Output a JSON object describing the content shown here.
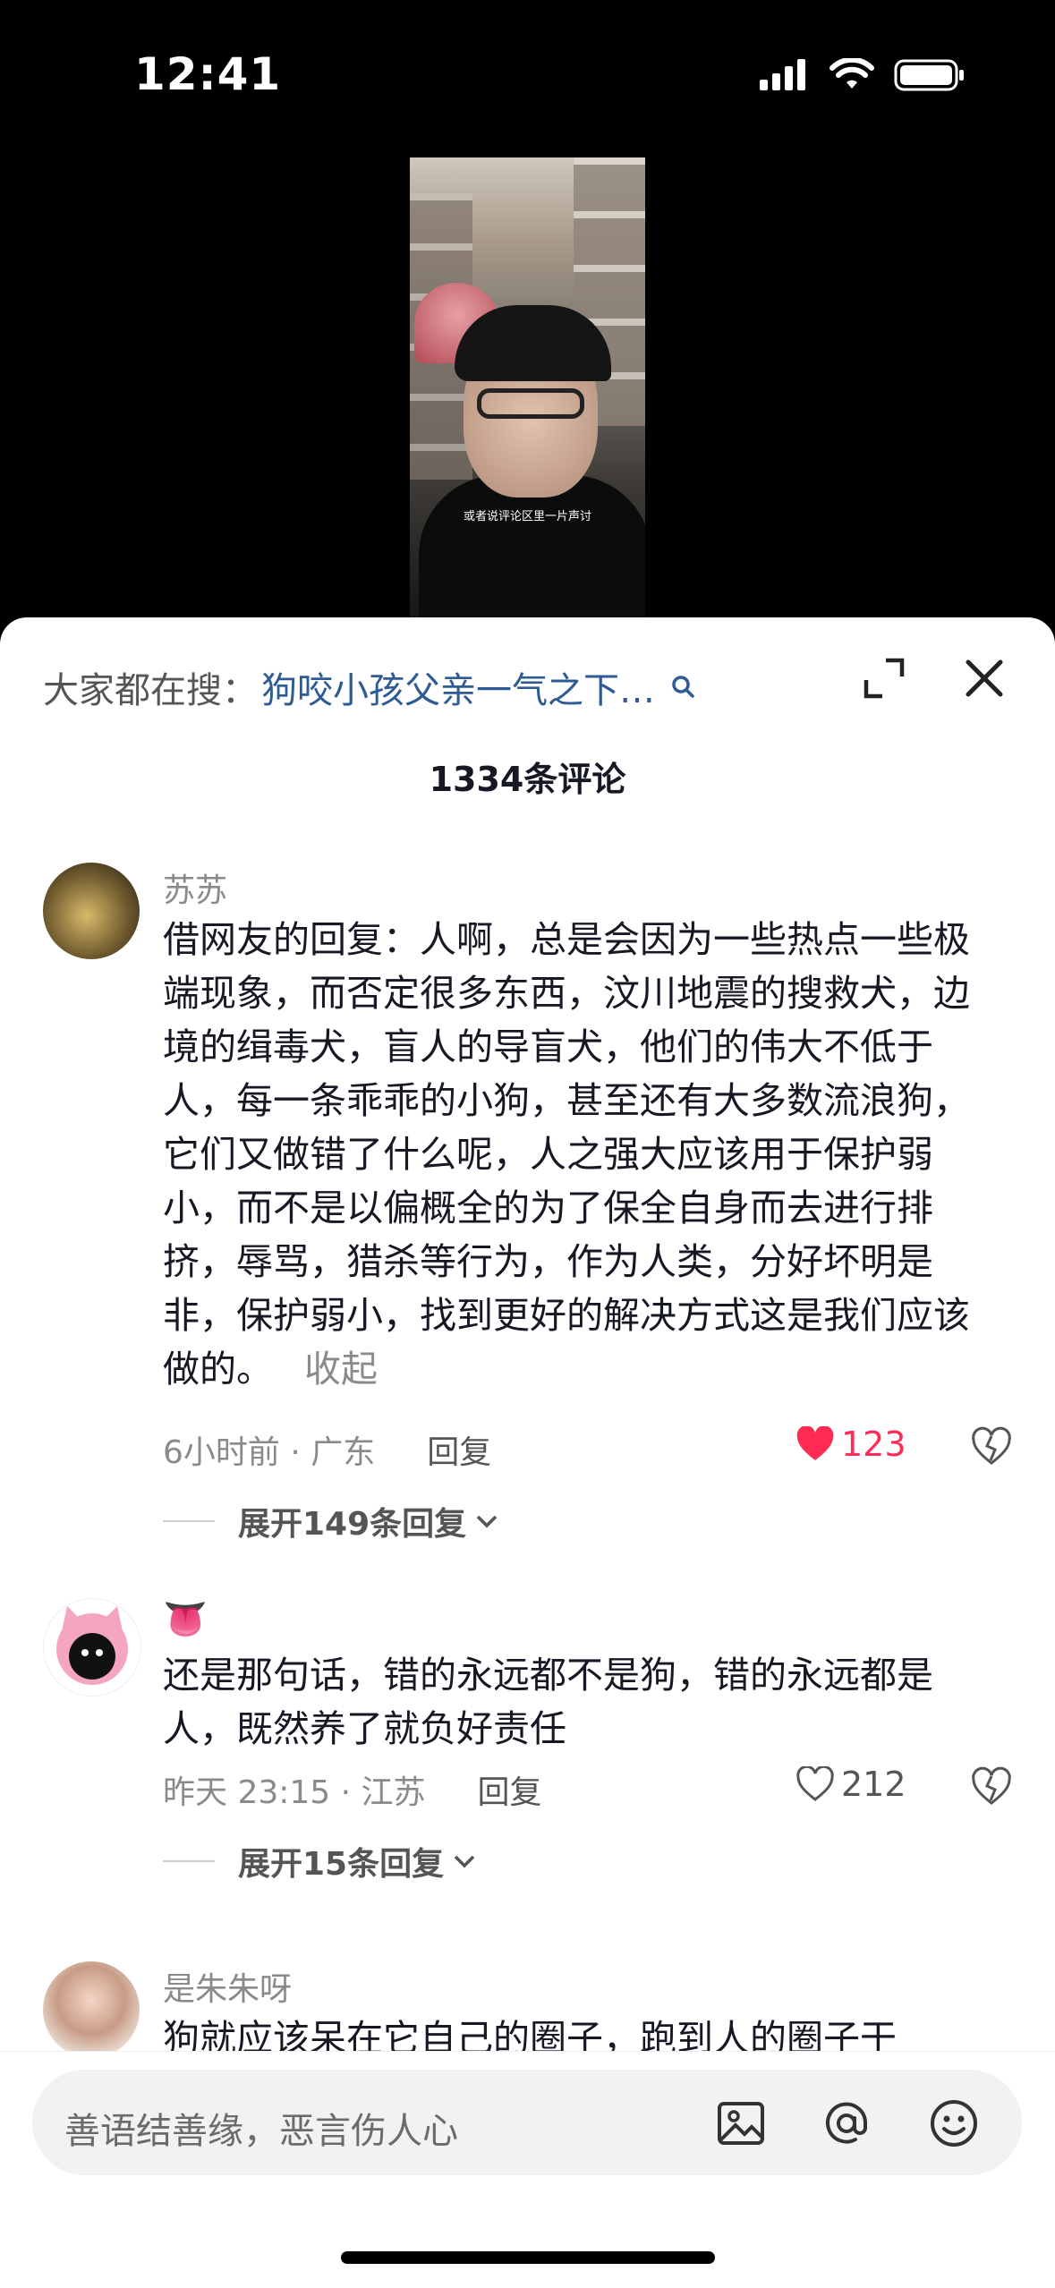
{
  "status_bar": {
    "time": "12:41"
  },
  "video": {
    "caption": "或者说评论区里一片声讨"
  },
  "sheet": {
    "search_label": "大家都在搜：",
    "search_query": "狗咬小孩父亲一气之下…",
    "comment_count": "1334条评论"
  },
  "comments": [
    {
      "username": "苏苏",
      "text": "借网友的回复：人啊，总是会因为一些热点一些极端现象，而否定很多东西，汶川地震的搜救犬，边境的缉毒犬，盲人的导盲犬，他们的伟大不低于人，每一条乖乖的小狗，甚至还有大多数流浪狗，它们又做错了什么呢，人之强大应该用于保护弱小，而不是以偏概全的为了保全自身而去进行排挤，辱骂，猎杀等行为，作为人类，分好坏明是非，保护弱小，找到更好的解决方式这是我们应该做的。",
      "collapse_label": "收起",
      "meta": "6小时前 · 广东",
      "reply_label": "回复",
      "likes": "123",
      "liked": true,
      "expand_replies": "展开149条回复"
    },
    {
      "username": "👅",
      "text": "还是那句话，错的永远都不是狗，错的永远都是人，既然养了就负好责任",
      "meta": "昨天 23:15 · 江苏",
      "reply_label": "回复",
      "likes": "212",
      "liked": false,
      "expand_replies": "展开15条回复"
    },
    {
      "username": "是朱朱呀",
      "text": "狗就应该呆在它自己的圈子，跑到人的圈子干"
    }
  ],
  "input": {
    "placeholder": "善语结善缘，恶言伤人心"
  },
  "colors": {
    "like_active": "#fe2c55",
    "search_query": "#2f5b95"
  },
  "icons": [
    "signal-icon",
    "wifi-icon",
    "battery-icon",
    "search-icon",
    "expand-icon",
    "close-icon",
    "heart-icon",
    "dislike-icon",
    "chevron-down-icon",
    "image-icon",
    "at-icon",
    "emoji-icon"
  ]
}
